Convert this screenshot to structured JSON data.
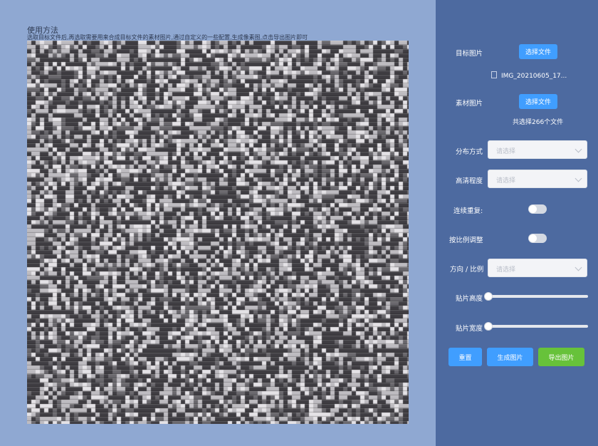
{
  "usage": {
    "title": "使用方法",
    "description": "选取目标文件后,再选取需要用来合成目标文件的素材图片,通过自定义的一些配置,生成像素图,点击导出图片即可"
  },
  "panel": {
    "target_label": "目标图片",
    "choose_file_label": "选择文件",
    "target_file_name": "IMG_20210605_17...",
    "material_label": "素材图片",
    "material_count_text": "共选择266个文件",
    "distribution_label": "分布方式",
    "clarity_label": "高清程度",
    "continuous_repeat_label": "连续重复:",
    "scale_adjust_label": "按比例调整",
    "direction_label": "方向 / 比例",
    "select_placeholder": "请选择",
    "tile_height_label": "贴片高度",
    "tile_width_label": "贴片宽度",
    "reset_label": "重置",
    "generate_label": "生成图片",
    "export_label": "导出图片"
  },
  "state": {
    "continuous_repeat_on": false,
    "scale_adjust_on": false,
    "tile_height_value": 0,
    "tile_width_value": 0
  },
  "colors": {
    "left_bg": "#8fa8d2",
    "panel_bg": "#4d6aa0",
    "primary": "#409eff",
    "success": "#67c23a",
    "mosaic_dark": "#3d3b40",
    "mosaic_light": "#c4c2c6"
  }
}
